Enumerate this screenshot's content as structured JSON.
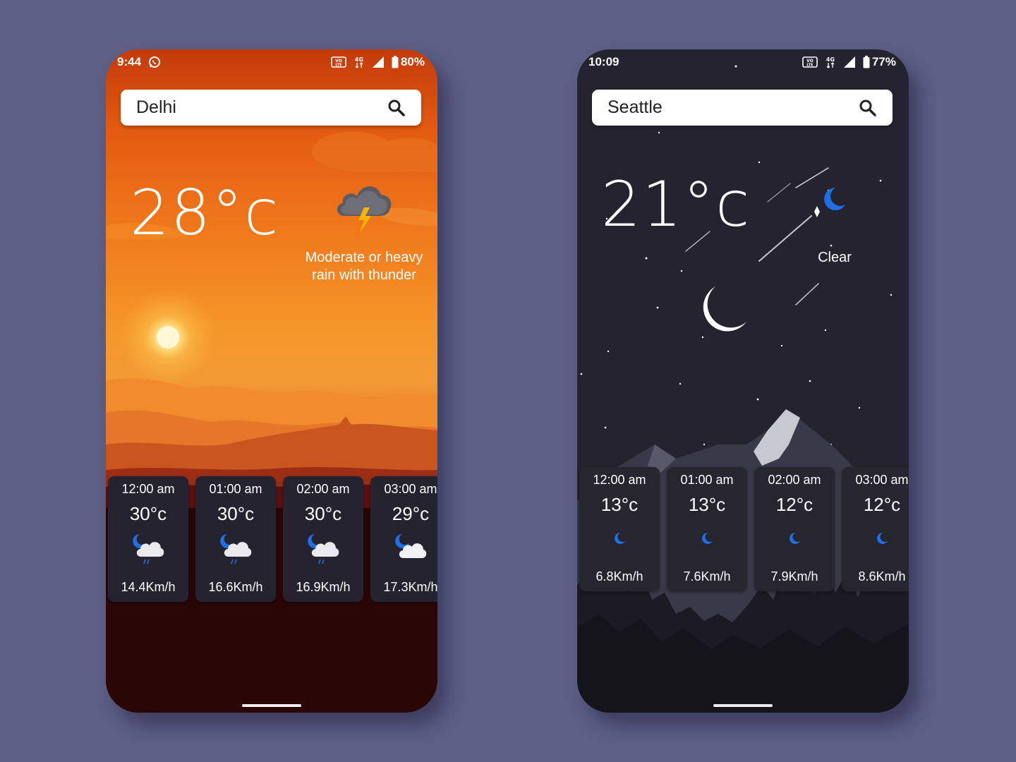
{
  "screens": [
    {
      "status": {
        "time": "9:44",
        "battery": "80%"
      },
      "search": {
        "value": "Delhi"
      },
      "current": {
        "temperature": "28°c",
        "condition": "Moderate or heavy rain with thunder",
        "icon": "thunder-cloud-icon"
      },
      "hourly": [
        {
          "time": "12:00 am",
          "temp": "30°c",
          "wind": "14.4Km/h",
          "icon": "moon-cloud-rain-icon"
        },
        {
          "time": "01:00 am",
          "temp": "30°c",
          "wind": "16.6Km/h",
          "icon": "moon-cloud-rain-icon"
        },
        {
          "time": "02:00 am",
          "temp": "30°c",
          "wind": "16.9Km/h",
          "icon": "moon-cloud-rain-icon"
        },
        {
          "time": "03:00 am",
          "temp": "29°c",
          "wind": "17.3Km/h",
          "icon": "moon-cloud-icon"
        }
      ]
    },
    {
      "status": {
        "time": "10:09",
        "battery": "77%"
      },
      "search": {
        "value": "Seattle"
      },
      "current": {
        "temperature": "21°c",
        "condition": "Clear",
        "icon": "moon-icon"
      },
      "hourly": [
        {
          "time": "12:00 am",
          "temp": "13°c",
          "wind": "6.8Km/h",
          "icon": "moon-icon"
        },
        {
          "time": "01:00 am",
          "temp": "13°c",
          "wind": "7.6Km/h",
          "icon": "moon-icon"
        },
        {
          "time": "02:00 am",
          "temp": "12°c",
          "wind": "7.9Km/h",
          "icon": "moon-icon"
        },
        {
          "time": "03:00 am",
          "temp": "12°c",
          "wind": "8.6Km/h",
          "icon": "moon-icon"
        }
      ]
    }
  ],
  "colors": {
    "page_bg": "#5e5f87",
    "card_bg": "#24232f",
    "moon_blue": "#1e6fe8",
    "bolt": "#f5b400"
  }
}
